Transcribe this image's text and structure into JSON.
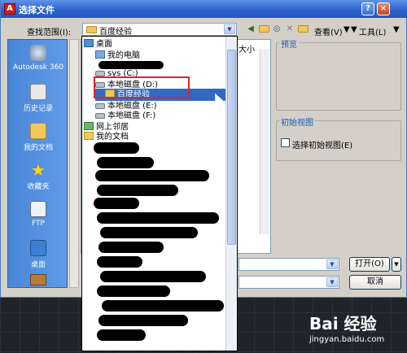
{
  "window": {
    "title": "选择文件",
    "app_logo": "A"
  },
  "toolbar": {
    "look_in_label": "查找范围(I):",
    "look_in_value": "百度经验",
    "view_label": "查看(V)",
    "tools_label": "工具(L)",
    "icons": [
      "back-icon",
      "up-folder-icon",
      "search-web-icon",
      "delete-icon",
      "new-folder-icon"
    ]
  },
  "places": [
    {
      "label": "Autodesk 360",
      "icon": "cloud-icon"
    },
    {
      "label": "历史记录",
      "icon": "history-icon"
    },
    {
      "label": "我的文档",
      "icon": "my-documents-icon"
    },
    {
      "label": "收藏夹",
      "icon": "favorites-icon"
    },
    {
      "label": "FTP",
      "icon": "ftp-icon"
    },
    {
      "label": "桌面",
      "icon": "desktop-icon"
    }
  ],
  "filelist": {
    "size_column": "大小"
  },
  "preview": {
    "label": "预览"
  },
  "initial_view": {
    "group_label": "初始视图",
    "checkbox_label": "选择初始视图(E)"
  },
  "buttons": {
    "open": "打开(O)",
    "cancel": "取消"
  },
  "tree": {
    "desktop": "桌面",
    "my_computer": "我的电脑",
    "sys_drive": "sys (C:)",
    "local_d": "本地磁盘 (D:)",
    "selected_folder": "百度经验",
    "local_e": "本地磁盘 (E:)",
    "local_f": "本地磁盘 (F:)",
    "network": "网上邻居",
    "my_docs": "我的文档"
  },
  "watermark": {
    "brand": "Bai 经验",
    "url": "jingyan.baidu.com"
  },
  "colors": {
    "titlebar": "#2e63c9",
    "selection": "#316ac5",
    "highlight_box": "#d8262a",
    "places_bg": "#4a86d8"
  }
}
